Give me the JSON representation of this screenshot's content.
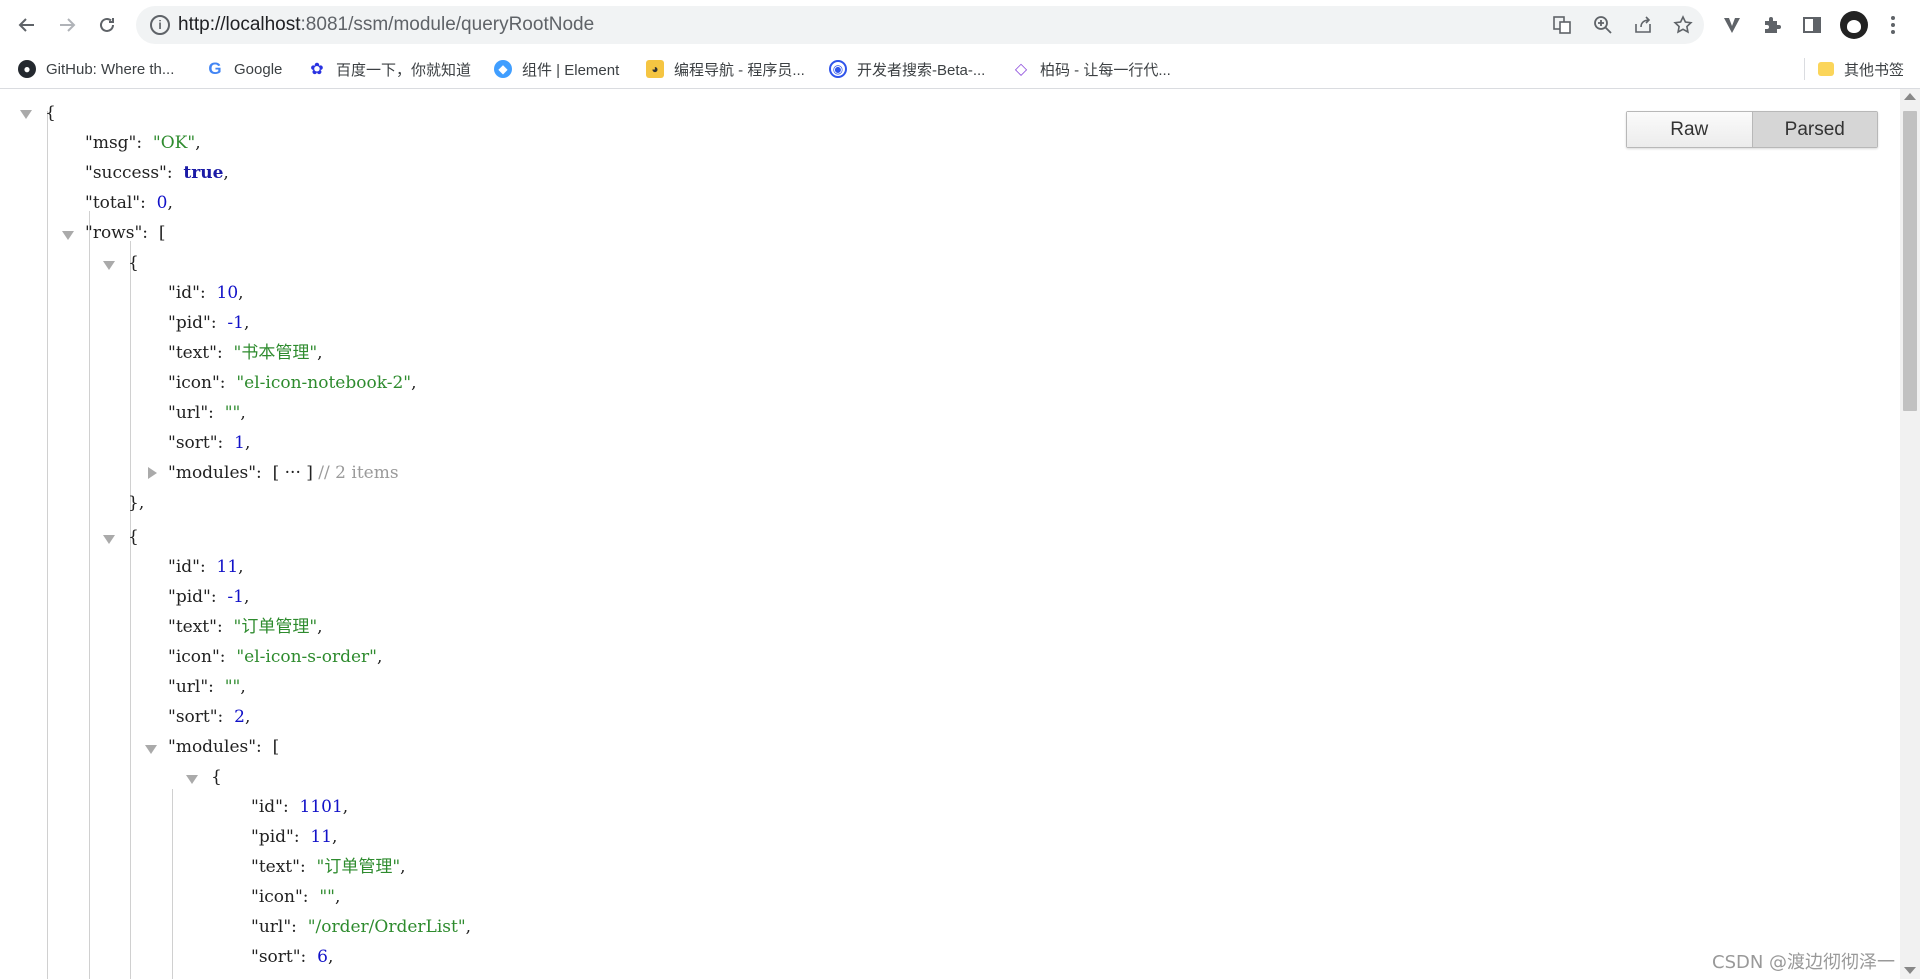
{
  "browser": {
    "url_host": "http://localhost",
    "url_rest": ":8081/ssm/module/queryRootNode",
    "icons": [
      "back-icon",
      "forward-icon",
      "reload-icon",
      "site-info-icon",
      "translate-icon",
      "zoom-icon",
      "share-icon",
      "star-icon",
      "extension-v-icon",
      "puzzle-icon",
      "sidepanel-icon",
      "avatar",
      "menu-dots-icon"
    ]
  },
  "bookmarks": [
    {
      "label": "GitHub: Where th...",
      "icon": "github-icon"
    },
    {
      "label": "Google",
      "icon": "google-icon"
    },
    {
      "label": "百度一下，你就知道",
      "icon": "baidu-icon"
    },
    {
      "label": "组件 | Element",
      "icon": "element-icon"
    },
    {
      "label": "编程导航 - 程序员...",
      "icon": "yupi-icon"
    },
    {
      "label": "开发者搜索-Beta-...",
      "icon": "dev-search-icon"
    },
    {
      "label": "柏码 - 让每一行代...",
      "icon": "itbaima-icon"
    },
    {
      "label": "其他书签",
      "icon": "folder-icon"
    }
  ],
  "viewer": {
    "raw_label": "Raw",
    "parsed_label": "Parsed",
    "syntax": {
      "open_brace": "{",
      "close_brace": "}",
      "close_brace_comma": "},",
      "open_bracket": "[",
      "collapsed": "[ ··· ]",
      "items_comment": "// 2 items"
    },
    "top": {
      "msg_key": "\"msg\":",
      "msg_val": "\"OK\"",
      "success_key": "\"success\":",
      "success_val": "true",
      "total_key": "\"total\":",
      "total_val": "0",
      "rows_key": "\"rows\":"
    },
    "row0": {
      "id_key": "\"id\":",
      "id_val": "10",
      "pid_key": "\"pid\":",
      "pid_val": "-1",
      "text_key": "\"text\":",
      "text_val": "\"书本管理\"",
      "icon_key": "\"icon\":",
      "icon_val": "\"el-icon-notebook-2\"",
      "url_key": "\"url\":",
      "url_val": "\"\"",
      "sort_key": "\"sort\":",
      "sort_val": "1",
      "modules_key": "\"modules\":"
    },
    "row1": {
      "id_key": "\"id\":",
      "id_val": "11",
      "pid_key": "\"pid\":",
      "pid_val": "-1",
      "text_key": "\"text\":",
      "text_val": "\"订单管理\"",
      "icon_key": "\"icon\":",
      "icon_val": "\"el-icon-s-order\"",
      "url_key": "\"url\":",
      "url_val": "\"\"",
      "sort_key": "\"sort\":",
      "sort_val": "2",
      "modules_key": "\"modules\":"
    },
    "row1_module0": {
      "id_key": "\"id\":",
      "id_val": "1101",
      "pid_key": "\"pid\":",
      "pid_val": "11",
      "text_key": "\"text\":",
      "text_val": "\"订单管理\"",
      "icon_key": "\"icon\":",
      "icon_val": "\"\"",
      "url_key": "\"url\":",
      "url_val": "\"/order/OrderList\"",
      "sort_key": "\"sort\":",
      "sort_val": "6"
    }
  },
  "watermark": "CSDN @渡边彻彻泽一"
}
